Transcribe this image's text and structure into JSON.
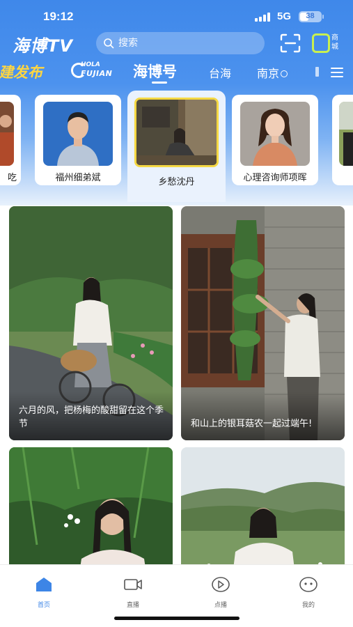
{
  "status_bar": {
    "time": "19:12",
    "network": "5G",
    "battery": "38"
  },
  "header": {
    "logo": "海博TV",
    "search": {
      "placeholder": "搜索"
    },
    "mall_label": "商城"
  },
  "channel_tabs": [
    {
      "label": "建发布"
    },
    {
      "label_top": "HOLA",
      "label_bottom": "FUJIAN"
    },
    {
      "label": "海博号",
      "active": true
    },
    {
      "label": "台海"
    },
    {
      "label": "南京"
    }
  ],
  "creators": [
    {
      "name": "吃"
    },
    {
      "name": "福州细弟斌"
    },
    {
      "name": "乡愁沈丹",
      "active": true
    },
    {
      "name": "心理咨询师项晖"
    }
  ],
  "feed": [
    {
      "caption": "六月的风，把杨梅的酸甜留在这个季节"
    },
    {
      "caption": "和山上的银耳菇农一起过端午!"
    },
    {
      "caption": ""
    },
    {
      "caption": ""
    }
  ],
  "bottom_nav": [
    {
      "label": "首页",
      "active": true,
      "icon": "home-icon"
    },
    {
      "label": "直播",
      "icon": "live-camera-icon"
    },
    {
      "label": "点播",
      "icon": "play-icon"
    },
    {
      "label": "我的",
      "icon": "profile-icon"
    }
  ],
  "colors": {
    "primary": "#3d85e6",
    "accent_yellow": "#f5d842",
    "mall_green": "#c8f050"
  }
}
